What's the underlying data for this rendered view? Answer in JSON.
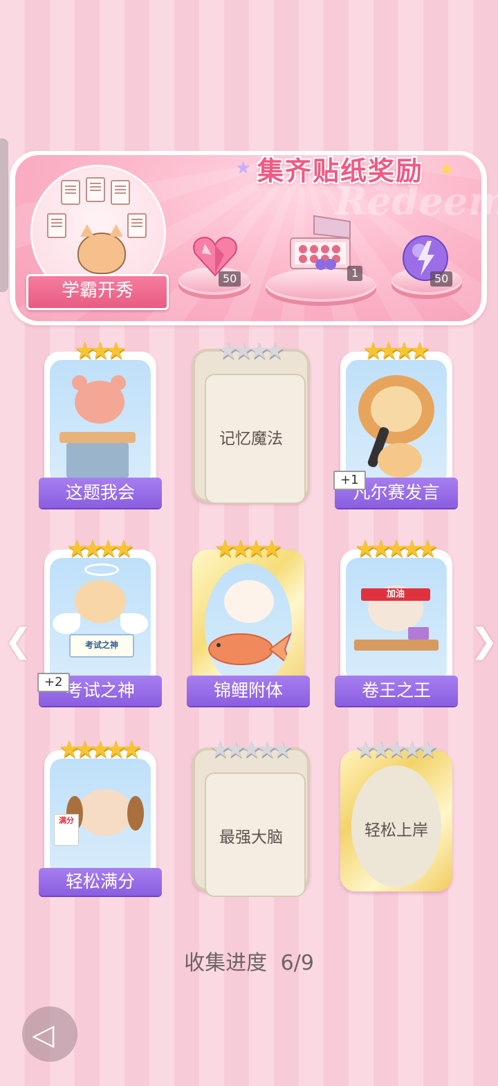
{
  "banner": {
    "title": "集齐贴纸奖励",
    "watermark": "Redeem",
    "sticker_title": "学霸开秀",
    "rewards": [
      {
        "name": "pink-heart-gem",
        "qty": "50"
      },
      {
        "name": "sticker-box",
        "qty": "1"
      },
      {
        "name": "lightning-orb",
        "qty": "50"
      }
    ]
  },
  "cards": [
    {
      "label": "这题我会",
      "stars": 3,
      "max": 3,
      "unlocked": true,
      "plus": ""
    },
    {
      "label": "记忆魔法",
      "stars": 0,
      "max": 4,
      "unlocked": false,
      "plus": ""
    },
    {
      "label": "凡尔赛发言",
      "stars": 4,
      "max": 4,
      "unlocked": true,
      "plus": "+1"
    },
    {
      "label": "考试之神",
      "stars": 4,
      "max": 4,
      "unlocked": true,
      "plus": "+2"
    },
    {
      "label": "锦鲤附体",
      "stars": 4,
      "max": 4,
      "unlocked": true,
      "plus": ""
    },
    {
      "label": "卷王之王",
      "stars": 5,
      "max": 5,
      "unlocked": true,
      "plus": ""
    },
    {
      "label": "轻松满分",
      "stars": 5,
      "max": 5,
      "unlocked": true,
      "plus": ""
    },
    {
      "label": "最强大脑",
      "stars": 0,
      "max": 5,
      "unlocked": false,
      "plus": ""
    },
    {
      "label": "轻松上岸",
      "stars": 0,
      "max": 5,
      "unlocked": false,
      "plus": ""
    }
  ],
  "card_texts": {
    "test_sign": "考试之神",
    "cheer_band": "加油",
    "full_mark": "满分"
  },
  "progress": {
    "label": "收集进度",
    "value": "6/9"
  },
  "colors": {
    "accent": "#f05a84",
    "label_purple": "#8a5ee0",
    "gold": "#f7c531"
  }
}
